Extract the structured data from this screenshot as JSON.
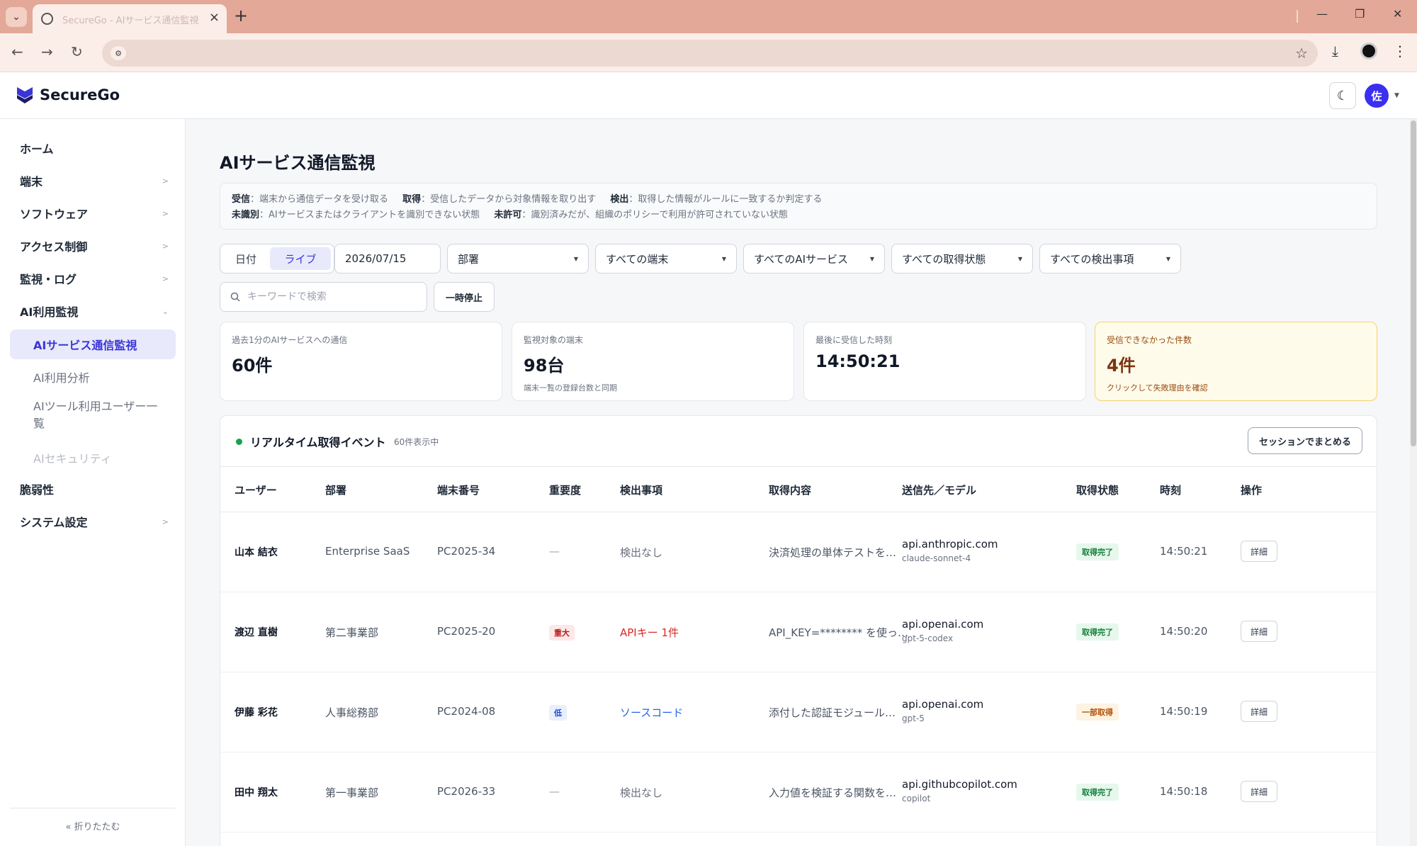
{
  "browser": {
    "tab_title": "SecureGo - AIサービス通信監視",
    "url": ""
  },
  "app": {
    "brand": "SecureGo",
    "brand_color": "#3b35d6",
    "avatar_initial": "佐"
  },
  "sidebar": {
    "items": [
      {
        "label": "ホーム"
      },
      {
        "label": "端末"
      },
      {
        "label": "ソフトウェア"
      },
      {
        "label": "アクセス制御"
      },
      {
        "label": "監視・ログ"
      },
      {
        "label": "AI利用監視"
      },
      {
        "label": "脆弱性"
      },
      {
        "label": "システム設定"
      }
    ],
    "sub_items": [
      {
        "label": "AIサービス通信監視",
        "active": true
      },
      {
        "label": "AI利用分析"
      },
      {
        "label": "AIツール利用ユーザー一覧"
      },
      {
        "label": "AIセキュリティ",
        "disabled": true
      }
    ],
    "collapse_label": "« 折りたたむ"
  },
  "page": {
    "title": "AIサービス通信監視",
    "legend": {
      "received_term": "受信",
      "received_desc": "：端末から通信データを受け取る",
      "acquired_term": "取得",
      "acquired_desc": "：受信したデータから対象情報を取り出す",
      "detected_term": "検出",
      "detected_desc": "：取得した情報がルールに一致するか判定する",
      "unidentified_term": "未識別",
      "unidentified_desc": "：AIサービスまたはクライアントを識別できない状態",
      "unauthorized_term": "未許可",
      "unauthorized_desc": "：識別済みだが、組織のポリシーで利用が許可されていない状態"
    }
  },
  "filters": {
    "mode_date": "日付",
    "mode_live": "ライブ",
    "date": "2026/07/15",
    "department": "部署",
    "devices": "すべての端末",
    "services": "すべてのAIサービス",
    "acquisition": "すべての取得状態",
    "detections": "すべての検出事項",
    "search_placeholder": "キーワードで検索",
    "pause_label": "一時停止"
  },
  "stats": [
    {
      "label": "過去1分のAIサービスへの通信",
      "value": "60件",
      "sub": ""
    },
    {
      "label": "監視対象の端末",
      "value": "98台",
      "sub": "端末一覧の登録台数と同期"
    },
    {
      "label": "最後に受信した時刻",
      "value": "14:50:21",
      "sub": ""
    },
    {
      "label": "受信できなかった件数",
      "value": "4件",
      "sub": "クリックして失敗理由を確認"
    }
  ],
  "events": {
    "title": "リアルタイム取得イベント",
    "count": "60件表示中",
    "session_button": "セッションでまとめる",
    "columns": [
      "ユーザー",
      "部署",
      "端末番号",
      "重要度",
      "検出事項",
      "取得内容",
      "送信先／モデル",
      "取得状態",
      "時刻",
      "操作"
    ],
    "rows": [
      {
        "user": "山本 結衣",
        "dept": "Enterprise SaaS",
        "device": "PC2025-34",
        "severity": "—",
        "detection": "検出なし",
        "content": "決済処理の単体テストを…",
        "host": "api.anthropic.com",
        "model": "claude-sonnet-4",
        "status": "取得完了",
        "time": "14:50:21",
        "action": "詳細"
      },
      {
        "user": "渡辺 直樹",
        "dept": "第二事業部",
        "device": "PC2025-20",
        "severity": "重大",
        "detection": "APIキー 1件",
        "content": "API_KEY=******** を使っ…",
        "host": "api.openai.com",
        "model": "gpt-5-codex",
        "status": "取得完了",
        "time": "14:50:20",
        "action": "詳細"
      },
      {
        "user": "伊藤 彩花",
        "dept": "人事総務部",
        "device": "PC2024-08",
        "severity": "低",
        "detection": "ソースコード",
        "content": "添付した認証モジュール…",
        "host": "api.openai.com",
        "model": "gpt-5",
        "status": "一部取得",
        "time": "14:50:19",
        "action": "詳細"
      },
      {
        "user": "田中 翔太",
        "dept": "第一事業部",
        "device": "PC2026-33",
        "severity": "—",
        "detection": "検出なし",
        "content": "入力値を検証する関数を…",
        "host": "api.githubcopilot.com",
        "model": "copilot",
        "status": "取得完了",
        "time": "14:50:18",
        "action": "詳細"
      }
    ]
  }
}
